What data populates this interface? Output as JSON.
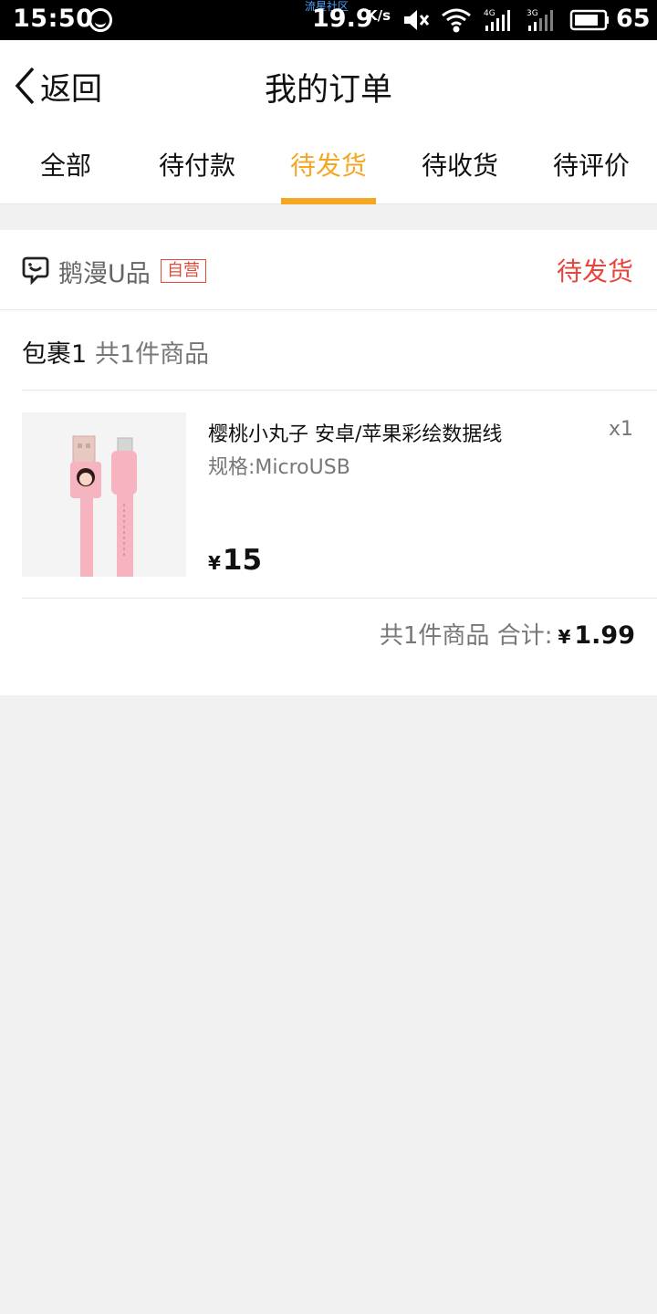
{
  "status_bar": {
    "time": "15:50",
    "carrier_label": "流星社区",
    "net_speed": "19.9",
    "net_speed_unit": "K/s",
    "battery": "65"
  },
  "header": {
    "back_label": "返回",
    "title": "我的订单"
  },
  "tabs": [
    {
      "label": "全部",
      "active": false
    },
    {
      "label": "待付款",
      "active": false
    },
    {
      "label": "待发货",
      "active": true
    },
    {
      "label": "待收货",
      "active": false
    },
    {
      "label": "待评价",
      "active": false
    }
  ],
  "order": {
    "shop_name": "鹅漫U品",
    "shop_badge": "自营",
    "status": "待发货",
    "package_label": "包裹1",
    "package_count": "共1件商品",
    "product": {
      "name": "樱桃小丸子 安卓/苹果彩绘数据线",
      "spec": "规格:MicroUSB",
      "qty": "x1",
      "currency": "¥",
      "price": "15"
    },
    "summary": {
      "count_text": "共1件商品",
      "total_label": "合计:",
      "currency": "¥",
      "total": "1.99"
    }
  },
  "colors": {
    "accent": "#f5a623",
    "status_red": "#e8453c",
    "page_bg": "#f1f1f1"
  }
}
